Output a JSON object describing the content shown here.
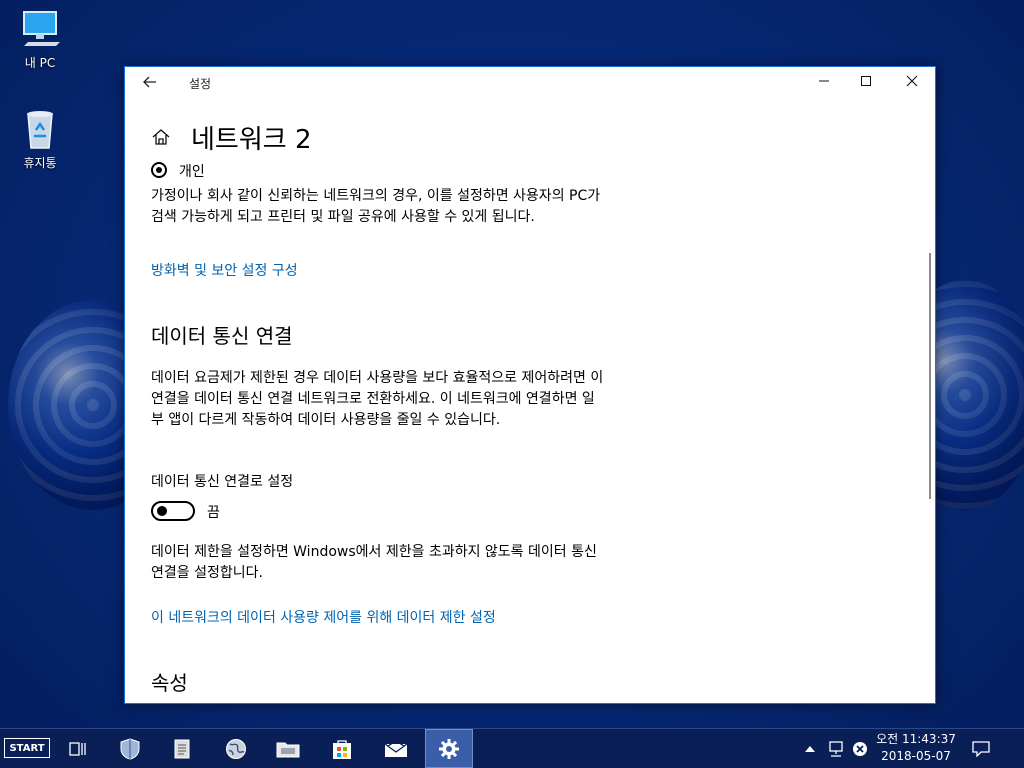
{
  "desktop": {
    "icons": [
      {
        "label": "내 PC",
        "icon": "computer-icon"
      },
      {
        "label": "휴지통",
        "icon": "recycle-bin-icon"
      }
    ]
  },
  "window": {
    "title": "설정",
    "controls": [
      "back-icon",
      "minimize-icon",
      "maximize-icon",
      "close-icon"
    ]
  },
  "page": {
    "title": "네트워크 2",
    "radio_label": "개인",
    "private_desc": "가정이나 회사 같이 신뢰하는 네트워크의 경우, 이를 설정하면 사용자의 PC가 검색 가능하게 되고 프린터 및 파일 공유에 사용할 수 있게 됩니다.",
    "firewall_link": "방화벽 및 보안 설정 구성",
    "metered_title": "데이터 통신 연결",
    "metered_desc": "데이터 요금제가 제한된 경우 데이터 사용량을 보다 효율적으로 제어하려면 이 연결을 데이터 통신 연결 네트워크로 전환하세요. 이 네트워크에 연결하면 일부 앱이 다르게 작동하여 데이터 사용량을 줄일 수 있습니다.",
    "metered_toggle_label": "데이터 통신 연결로 설정",
    "metered_toggle_state": "끔",
    "limit_desc": "데이터 제한을 설정하면 Windows에서 제한을 초과하지 않도록 데이터 통신 연결을 설정합니다.",
    "limit_link": "이 네트워크의 데이터 사용량 제어를 위해 데이터 제한 설정",
    "properties_title": "속성"
  },
  "taskbar": {
    "start_label": "START",
    "items": [
      "task-view-icon",
      "shield-icon",
      "document-icon",
      "globe-icon",
      "file-explorer-icon",
      "store-icon",
      "mail-icon",
      "settings-gear-icon"
    ],
    "active_item": "settings-gear-icon",
    "tray_icons": [
      "chevron-up-icon",
      "network-icon",
      "volume-muted-icon",
      "notification-icon"
    ],
    "clock_time": "오전 11:43:37",
    "clock_date": "2018-05-07"
  },
  "colors": {
    "link": "#0063b1",
    "window_border": "#1c6fd6",
    "taskbar": "#0a1f55"
  }
}
